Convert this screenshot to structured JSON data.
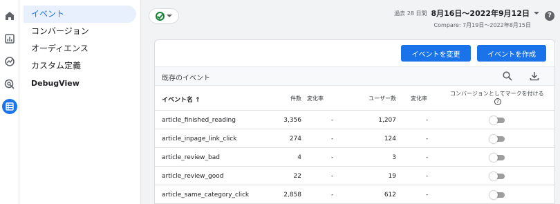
{
  "rail": {
    "items": [
      {
        "icon": "home-icon"
      },
      {
        "icon": "bar-chart-icon"
      },
      {
        "icon": "trend-icon"
      },
      {
        "icon": "target-icon"
      },
      {
        "icon": "list-icon",
        "active": true
      }
    ]
  },
  "nav": {
    "items": [
      {
        "label": "イベント",
        "active": true
      },
      {
        "label": "コンバージョン"
      },
      {
        "label": "オーディエンス"
      },
      {
        "label": "カスタム定義"
      },
      {
        "label": "DebugView"
      }
    ]
  },
  "header": {
    "date_prefix": "過去 28 日間",
    "date_range": "8月16日～2022年9月12日",
    "compare": "Compare: 7月19日～2022年8月15日",
    "help": "?"
  },
  "card": {
    "modify_button": "イベントを変更",
    "create_button": "イベントを作成",
    "toolbar_title": "既存のイベント",
    "columns": {
      "name": "イベント名 ↑",
      "count": "件数",
      "rate": "変化率",
      "users": "ユーザー数",
      "user_rate": "変化率",
      "conversion": "コンバージョンとしてマークを付ける",
      "conversion_help": "?"
    },
    "rows": [
      {
        "name": "article_finished_reading",
        "count": "3,356",
        "rate": "-",
        "users": "1,207",
        "user_rate": "-",
        "conversion": false
      },
      {
        "name": "article_inpage_link_click",
        "count": "274",
        "rate": "-",
        "users": "124",
        "user_rate": "-",
        "conversion": false
      },
      {
        "name": "article_review_bad",
        "count": "4",
        "rate": "-",
        "users": "3",
        "user_rate": "-",
        "conversion": false
      },
      {
        "name": "article_review_good",
        "count": "22",
        "rate": "-",
        "users": "19",
        "user_rate": "-",
        "conversion": false
      },
      {
        "name": "article_same_category_click",
        "count": "2,858",
        "rate": "-",
        "users": "612",
        "user_rate": "-",
        "conversion": false
      }
    ]
  },
  "colors": {
    "accent": "#1a73e8",
    "status_ok": "#188038",
    "nav_active_bg": "#e8f0fe"
  }
}
